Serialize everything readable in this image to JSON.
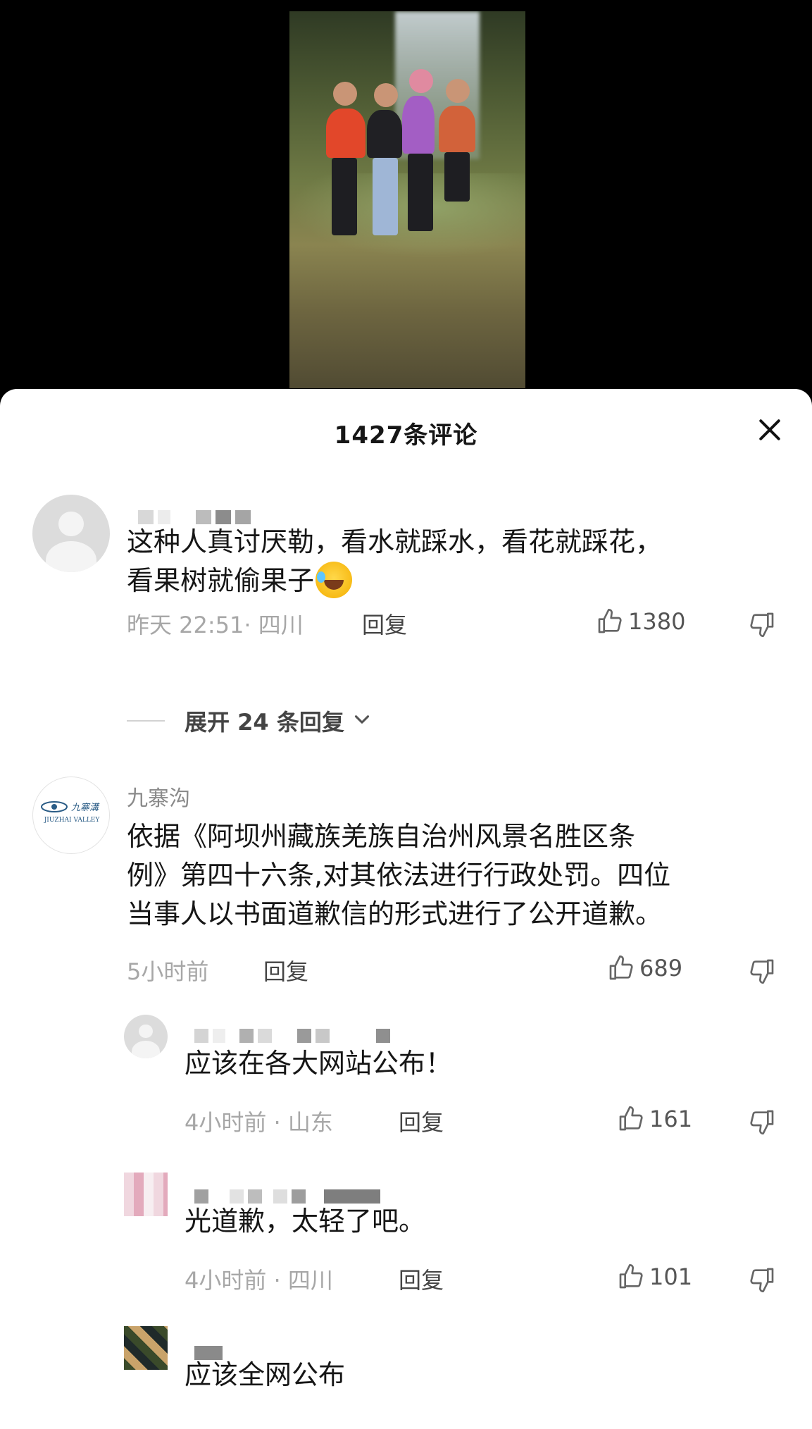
{
  "header": {
    "title": "1427条评论",
    "close_icon": "close-icon"
  },
  "comments": [
    {
      "username": "",
      "body_line1": "这种人真讨厌勒，看水就踩水，看花就踩花，",
      "body_line2": "看果树就偷果子",
      "emoji": "laughing-tears-emoji",
      "meta": "昨天 22:51· 四川",
      "reply_label": "回复",
      "likes": "1380",
      "expand_label": "展开 24 条回复"
    },
    {
      "username": "九寨沟",
      "avatar_text": "JIUZHAI VALLEY",
      "body_line1": "依据《阿坝州藏族羌族自治州风景名胜区条",
      "body_line2": "例》第四十六条,对其依法进行行政处罚。四位",
      "body_line3": "当事人以书面道歉信的形式进行了公开道歉。",
      "meta": "5小时前",
      "reply_label": "回复",
      "likes": "689"
    }
  ],
  "replies": [
    {
      "body": "应该在各大网站公布！",
      "meta": "4小时前 · 山东",
      "reply_label": "回复",
      "likes": "161"
    },
    {
      "body": "光道歉，太轻了吧。",
      "meta": "4小时前 · 四川",
      "reply_label": "回复",
      "likes": "101"
    },
    {
      "body": "应该全网公布"
    }
  ]
}
